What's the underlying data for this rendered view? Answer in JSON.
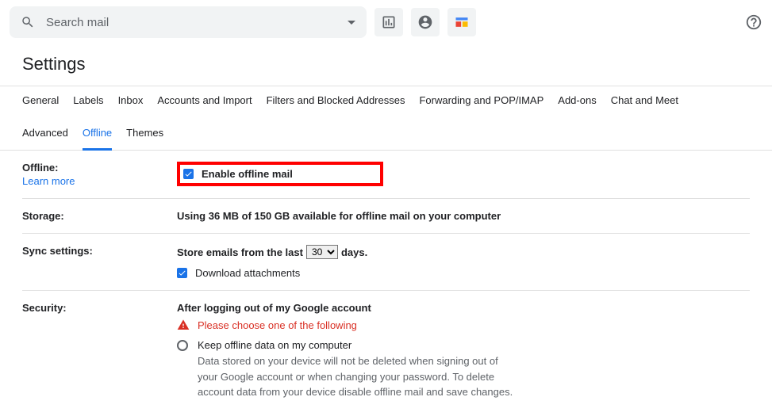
{
  "search": {
    "placeholder": "Search mail"
  },
  "title": "Settings",
  "tabs": {
    "row1": [
      "General",
      "Labels",
      "Inbox",
      "Accounts and Import",
      "Filters and Blocked Addresses",
      "Forwarding and POP/IMAP",
      "Add-ons",
      "Chat and Meet"
    ],
    "row2": [
      "Advanced",
      "Offline",
      "Themes"
    ],
    "active": "Offline"
  },
  "offline": {
    "label": "Offline:",
    "learn_more": "Learn more",
    "enable_label": "Enable offline mail"
  },
  "storage": {
    "label": "Storage:",
    "text": "Using 36 MB of 150 GB available for offline mail on your computer"
  },
  "sync": {
    "label": "Sync settings:",
    "prefix": "Store emails from the last",
    "selected": "30",
    "suffix": "days.",
    "download_label": "Download attachments"
  },
  "security": {
    "label": "Security:",
    "heading": "After logging out of my Google account",
    "warning": "Please choose one of the following",
    "option1_label": "Keep offline data on my computer",
    "option1_desc": "Data stored on your device will not be deleted when signing out of your Google account or when changing your password. To delete account data from your device disable offline mail and save changes."
  }
}
